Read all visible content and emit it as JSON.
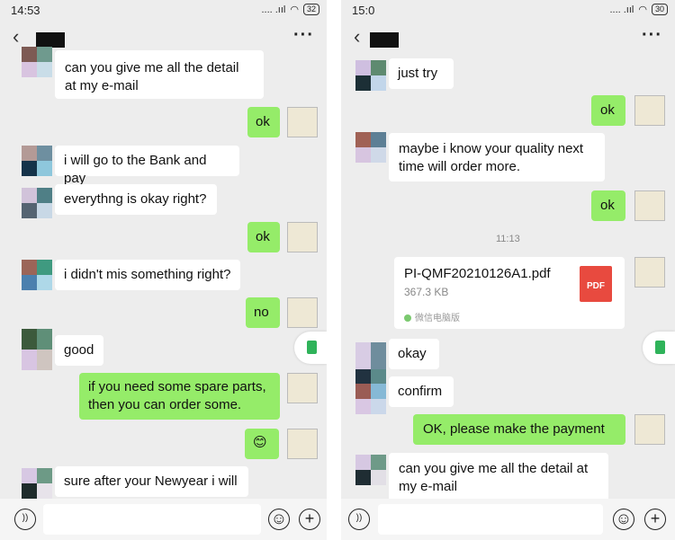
{
  "left": {
    "status_time": "14:53",
    "signal": ".... .ııl",
    "battery": "32",
    "more": "···",
    "messages": [
      {
        "text": "can you give me all the detail at my e-mail"
      },
      {
        "text": "ok"
      },
      {
        "text": "i will go to the Bank and pay"
      },
      {
        "text": "everythng is okay right?"
      },
      {
        "text": "ok"
      },
      {
        "text": "i didn't mis something right?"
      },
      {
        "text": "no"
      },
      {
        "text": "good"
      },
      {
        "text": "if you need some spare parts, then you can order some."
      },
      {
        "text": "😊"
      },
      {
        "text": "sure after your Newyear i will"
      }
    ]
  },
  "right": {
    "status_time": "15:0",
    "signal": ".... .ııl",
    "battery": "30",
    "more": "···",
    "timestamp": "11:13",
    "file": {
      "name": "PI-QMF20210126A1.pdf",
      "size": "367.3 KB",
      "badge": "PDF",
      "source": "微信电脑版"
    },
    "messages": [
      {
        "text": "just try"
      },
      {
        "text": "ok"
      },
      {
        "text": "maybe i know your quality next time will order more."
      },
      {
        "text": "ok"
      },
      {
        "text": "okay"
      },
      {
        "text": "confirm"
      },
      {
        "text": "OK, please make the payment"
      },
      {
        "text": "can you give me all the detail at my e-mail"
      }
    ]
  },
  "icons": {
    "back": "chevron-left-icon",
    "more": "more-dots-icon",
    "voice": "voice-icon",
    "emoji": "emoji-icon",
    "plus": "plus-icon",
    "doc": "document-icon"
  },
  "colors": {
    "bubble_out": "#95ec69",
    "bubble_in": "#ffffff",
    "background": "#ededed",
    "pdf": "#e84a3f"
  }
}
